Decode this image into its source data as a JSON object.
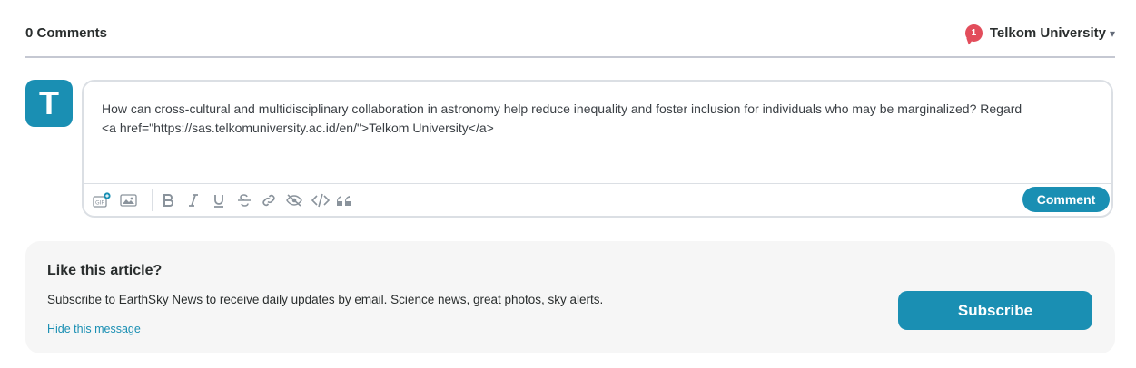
{
  "header": {
    "comment_count": "0 Comments",
    "notifications": "1",
    "user_name": "Telkom University",
    "caret": "▾"
  },
  "avatar": {
    "initial": "T"
  },
  "editor": {
    "text": "How can cross-cultural and multidisciplinary collaboration in astronomy help reduce inequality and foster inclusion for individuals who may be marginalized? Regard\n<a href=\"https://sas.telkomuniversity.ac.id/en/\">Telkom University</a>",
    "submit_label": "Comment",
    "tools": [
      "gif-icon",
      "image-icon",
      "bold-icon",
      "italic-icon",
      "underline-icon",
      "strikethrough-icon",
      "link-icon",
      "spoiler-icon",
      "code-icon",
      "quote-icon"
    ]
  },
  "promo": {
    "title": "Like this article?",
    "text": "Subscribe to EarthSky News to receive daily updates by email. Science news, great photos, sky alerts.",
    "hide_label": "Hide this message",
    "subscribe_label": "Subscribe"
  },
  "colors": {
    "accent": "#1a8fb3",
    "notification": "#e24d5b",
    "divider": "#c5c8d2",
    "toolbar_icon": "#8a939c"
  }
}
